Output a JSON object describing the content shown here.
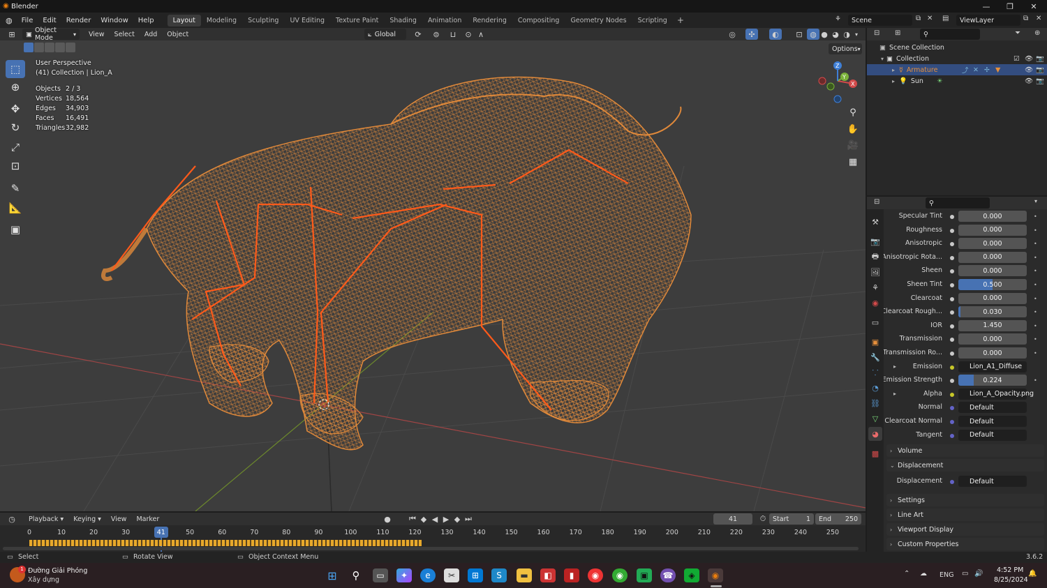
{
  "window": {
    "title": "Blender"
  },
  "menus": [
    "File",
    "Edit",
    "Render",
    "Window",
    "Help"
  ],
  "workspaces": [
    "Layout",
    "Modeling",
    "Sculpting",
    "UV Editing",
    "Texture Paint",
    "Shading",
    "Animation",
    "Rendering",
    "Compositing",
    "Geometry Nodes",
    "Scripting"
  ],
  "active_workspace": "Layout",
  "scene_name": "Scene",
  "view_layer": "ViewLayer",
  "viewport": {
    "mode": "Object Mode",
    "menus": [
      "View",
      "Select",
      "Add",
      "Object"
    ],
    "orientation": "Global",
    "options_label": "Options",
    "overlay_title": "User Perspective",
    "overlay_sub": "(41) Collection | Lion_A",
    "stats": [
      {
        "k": "Objects",
        "v": "2 / 3"
      },
      {
        "k": "Vertices",
        "v": "18,564"
      },
      {
        "k": "Edges",
        "v": "34,903"
      },
      {
        "k": "Faces",
        "v": "16,491"
      },
      {
        "k": "Triangles",
        "v": "32,982"
      }
    ],
    "gizmo": {
      "x": "X",
      "y": "Y",
      "z": "Z"
    },
    "wire_color": "#e0893a",
    "bone_color": "#ff5a1a"
  },
  "outliner": {
    "root": "Scene Collection",
    "collection": "Collection",
    "items": [
      {
        "label": "Armature",
        "color": "#e58f3c"
      },
      {
        "label": "Sun",
        "color": "#dcdcdc"
      }
    ]
  },
  "properties": {
    "rows": [
      {
        "label": "Specular Tint",
        "value": "0.000",
        "kind": "num"
      },
      {
        "label": "Roughness",
        "value": "0.000",
        "kind": "num"
      },
      {
        "label": "Anisotropic",
        "value": "0.000",
        "kind": "num"
      },
      {
        "label": "Anisotropic Rota...",
        "value": "0.000",
        "kind": "num"
      },
      {
        "label": "Sheen",
        "value": "0.000",
        "kind": "num"
      },
      {
        "label": "Sheen Tint",
        "value": "0.500",
        "kind": "active"
      },
      {
        "label": "Clearcoat",
        "value": "0.000",
        "kind": "num"
      },
      {
        "label": "Clearcoat Rough...",
        "value": "0.030",
        "kind": "num"
      },
      {
        "label": "IOR",
        "value": "1.450",
        "kind": "num"
      },
      {
        "label": "Transmission",
        "value": "0.000",
        "kind": "num"
      },
      {
        "label": "Transmission Ro...",
        "value": "0.000",
        "kind": "num"
      },
      {
        "label": "Emission",
        "value": "Lion_A1_Diffuse",
        "kind": "tex"
      },
      {
        "label": "Emission Strength",
        "value": "0.224",
        "kind": "num"
      },
      {
        "label": "Alpha",
        "value": "Lion_A_Opacity.png",
        "kind": "tex"
      },
      {
        "label": "Normal",
        "value": "Default",
        "kind": "vec"
      },
      {
        "label": "Clearcoat Normal",
        "value": "Default",
        "kind": "vec"
      },
      {
        "label": "Tangent",
        "value": "Default",
        "kind": "vec"
      }
    ],
    "panels": {
      "volume": "Volume",
      "displacement": "Displacement",
      "disp_label": "Displacement",
      "disp_value": "Default",
      "settings": "Settings",
      "lineart": "Line Art",
      "viewport_display": "Viewport Display",
      "custom_props": "Custom Properties"
    }
  },
  "timeline": {
    "menus": [
      "Playback",
      "Keying",
      "View",
      "Marker"
    ],
    "current_frame": "41",
    "start_label": "Start",
    "start": "1",
    "end_label": "End",
    "end": "250",
    "ticks": [
      "0",
      "10",
      "20",
      "30",
      "50",
      "60",
      "70",
      "80",
      "90",
      "100",
      "110",
      "120",
      "130",
      "140",
      "150",
      "160",
      "170",
      "180",
      "190",
      "200",
      "210",
      "220",
      "230",
      "240",
      "250"
    ],
    "tick_values": [
      0,
      10,
      20,
      30,
      50,
      60,
      70,
      80,
      90,
      100,
      110,
      120,
      130,
      140,
      150,
      160,
      170,
      180,
      190,
      200,
      210,
      220,
      230,
      240,
      250
    ],
    "keyframes_start": 0,
    "keyframes_end": 122
  },
  "statusbar": {
    "select": "Select",
    "rotate": "Rotate View",
    "context": "Object Context Menu",
    "version": "3.6.2"
  },
  "taskbar": {
    "weather_title": "Đường Giải Phóng",
    "weather_sub": "Xây dựng",
    "badge": "1",
    "lang": "ENG",
    "time": "4:52 PM",
    "date": "8/25/2024"
  }
}
